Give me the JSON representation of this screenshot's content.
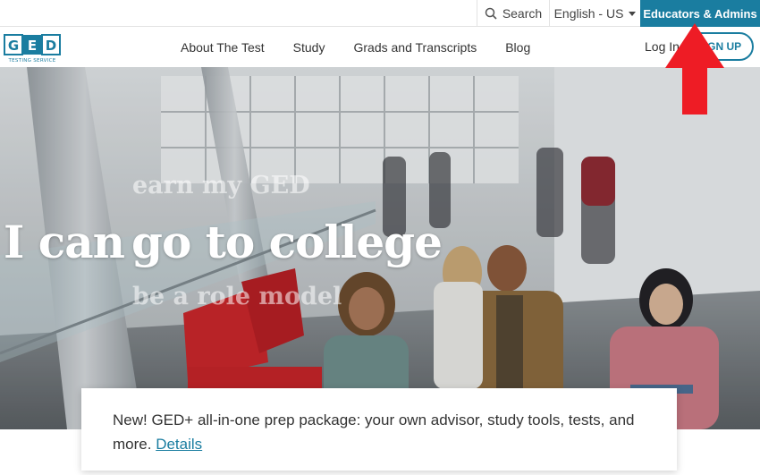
{
  "utility": {
    "search_label": "Search",
    "language_label": "English - US",
    "educators_label": "Educators & Admins"
  },
  "nav": {
    "logo_text": "GED",
    "logo_sub": "TESTING SERVICE",
    "links": [
      "About The Test",
      "Study",
      "Grads and Transcripts",
      "Blog"
    ],
    "login_label": "Log In",
    "signup_label": "SIGN UP"
  },
  "hero": {
    "line_top": "earn my GED",
    "line_main_a": "I can",
    "line_main_b": "go to college",
    "line_bottom": "be a role model"
  },
  "promo": {
    "text": "New! GED+ all-in-one prep package: your own advisor, study tools, tests, and more.",
    "link_label": "Details"
  },
  "colors": {
    "brand": "#1a7da0",
    "arrow": "#ee1c25"
  }
}
